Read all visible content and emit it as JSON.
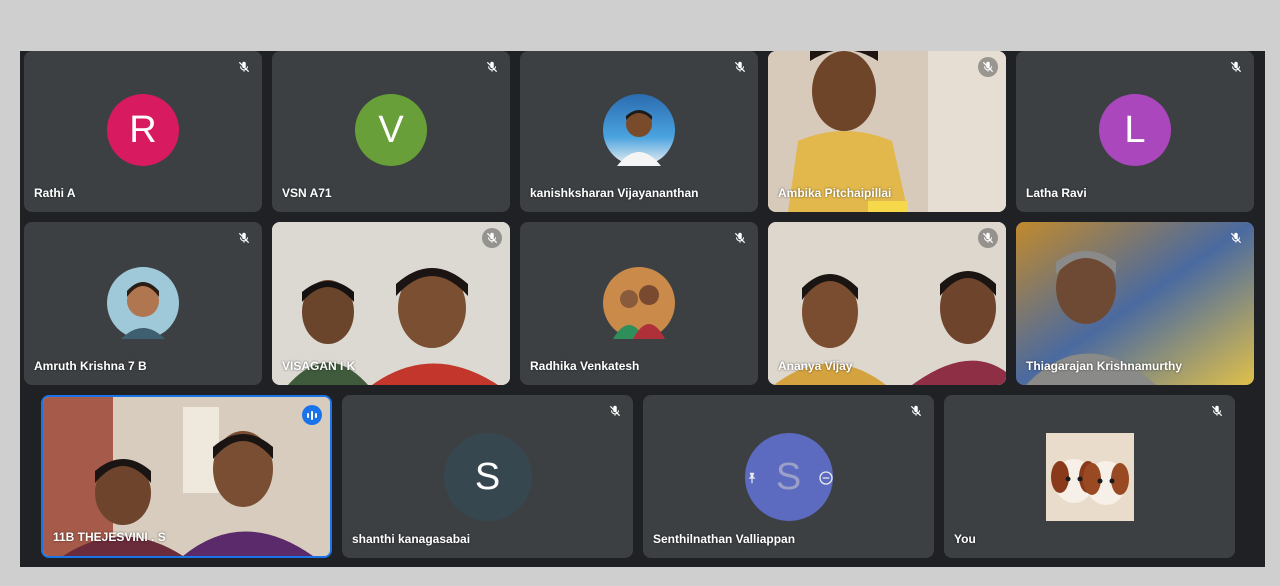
{
  "participants": {
    "rathi": {
      "name": "Rathi A",
      "initial": "R",
      "color": "#d81b60",
      "mic_icon": "mic-off-icon"
    },
    "vsn": {
      "name": "VSN A71",
      "initial": "V",
      "color": "#689f38",
      "mic_icon": "mic-off-icon"
    },
    "kanishk": {
      "name": "kanishksharan Vijayananthan",
      "mic_icon": "mic-off-icon"
    },
    "ambika": {
      "name": "Ambika Pitchaipillai",
      "mic_icon": "mic-off-icon"
    },
    "latha": {
      "name": "Latha Ravi",
      "initial": "L",
      "color": "#ab47bc",
      "mic_icon": "mic-off-icon"
    },
    "amruth": {
      "name": "Amruth Krishna 7 B",
      "mic_icon": "mic-off-icon"
    },
    "visagan": {
      "name": "VISAGAN I K",
      "mic_icon": "mic-off-icon"
    },
    "radhika": {
      "name": "Radhika Venkatesh",
      "mic_icon": "mic-off-icon"
    },
    "ananya": {
      "name": "Ananya Vijay",
      "mic_icon": "mic-off-icon"
    },
    "thiagarajan": {
      "name": "Thiagarajan Krishnamurthy",
      "mic_icon": "mic-off-icon"
    },
    "thejesvini": {
      "name": "11B THEJESVINI . S",
      "indicator": "speaking-icon"
    },
    "shanthi": {
      "name": "shanthi kanagasabai",
      "initial": "S",
      "color": "#37474f",
      "mic_icon": "mic-off-icon"
    },
    "senthil": {
      "name": "Senthilnathan Valliappan",
      "initial": "S",
      "color": "#5c6bc0",
      "mic_icon": "mic-off-icon",
      "overlay_icons": [
        "pin-icon",
        "remove-icon"
      ]
    },
    "you": {
      "name": "You",
      "mic_icon": "mic-off-icon"
    }
  },
  "colors": {
    "tile": "#3c4043",
    "background": "#202124",
    "speaking_border": "#1a73e8"
  }
}
